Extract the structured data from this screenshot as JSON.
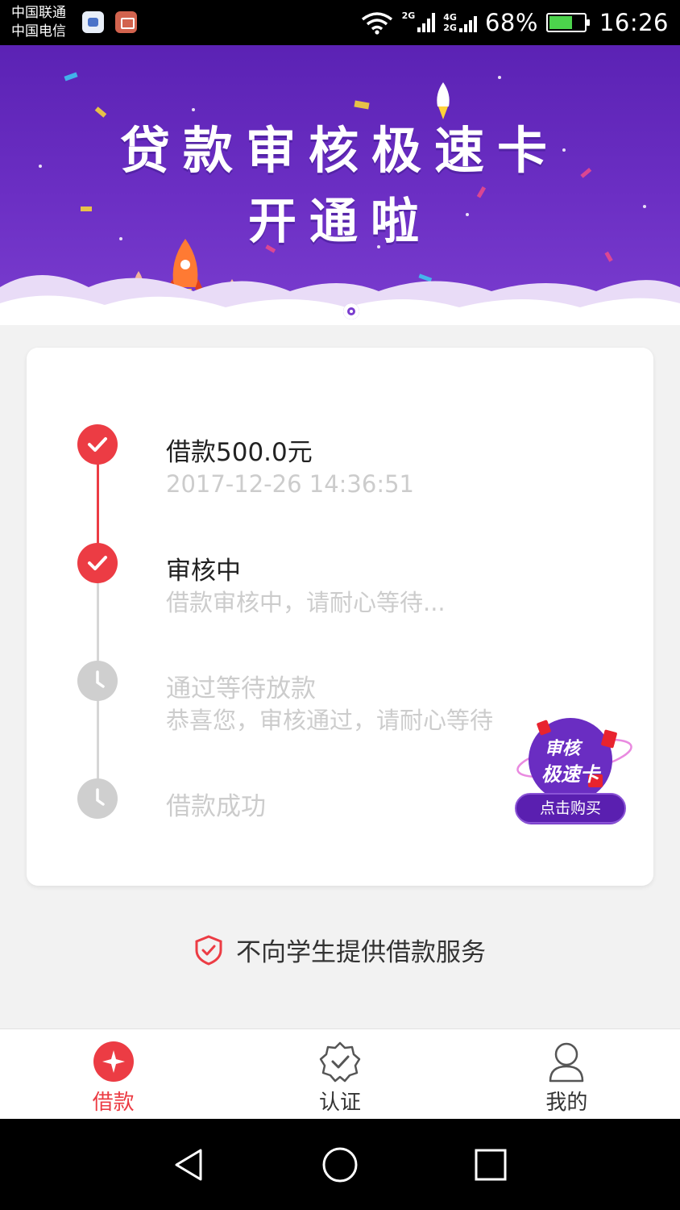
{
  "status_bar": {
    "carrier_1": "中国联通",
    "carrier_2": "中国电信",
    "net_1": "2G",
    "net_2_top": "4G",
    "net_2_bottom": "2G",
    "battery": "68%",
    "battery_level": 0.68,
    "time": "16:26"
  },
  "banner": {
    "line1": "贷款审核极速卡",
    "line2": "开通啦",
    "page_count": 2,
    "active_page": 2
  },
  "progress": {
    "steps": [
      {
        "title": "借款500.0元",
        "subtitle": "2017-12-26 14:36:51",
        "state": "done"
      },
      {
        "title": "审核中",
        "subtitle": "借款审核中，请耐心等待...",
        "state": "done"
      },
      {
        "title": "通过等待放款",
        "subtitle": "恭喜您，审核通过，请耐心等待",
        "state": "pending"
      },
      {
        "title": "借款成功",
        "subtitle": "",
        "state": "pending"
      }
    ]
  },
  "promo": {
    "line1": "审核",
    "line2": "极速卡",
    "button": "点击购买"
  },
  "notice": {
    "text": "不向学生提供借款服务"
  },
  "tabs": [
    {
      "label": "借款",
      "icon": "loan-icon",
      "active": true
    },
    {
      "label": "认证",
      "icon": "verify-badge-icon",
      "active": false
    },
    {
      "label": "我的",
      "icon": "user-icon",
      "active": false
    }
  ],
  "colors": {
    "accent": "#ec3c44",
    "banner": "#6a2dc2",
    "pending": "#cfcfcf"
  }
}
